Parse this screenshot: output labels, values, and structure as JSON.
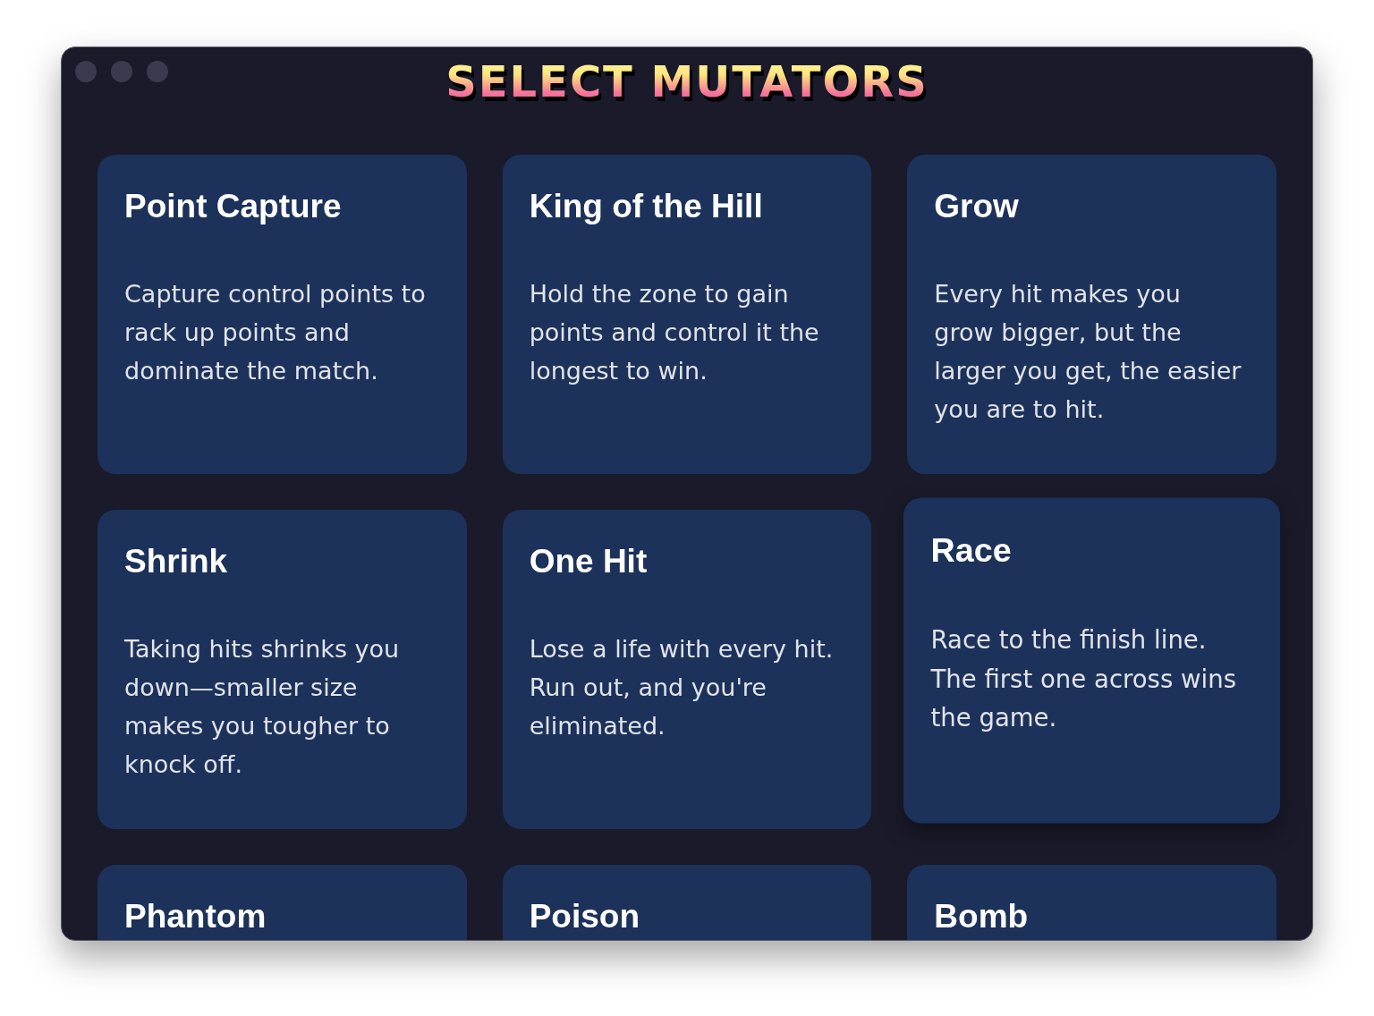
{
  "window": {
    "title": "SELECT MUTATORS"
  },
  "mutators": [
    {
      "name": "Point Capture",
      "description": "Capture control points to rack up points and dominate the match.",
      "hovered": false
    },
    {
      "name": "King of the Hill",
      "description": "Hold the zone to gain points and control it the longest to win.",
      "hovered": false
    },
    {
      "name": "Grow",
      "description": "Every hit makes you grow bigger, but the larger you get, the easier you are to hit.",
      "hovered": false
    },
    {
      "name": "Shrink",
      "description": "Taking hits shrinks you down—smaller size makes you tougher to knock off.",
      "hovered": false
    },
    {
      "name": "One Hit",
      "description": "Lose a life with every hit. Run out, and you're eliminated.",
      "hovered": false
    },
    {
      "name": "Race",
      "description": "Race to the finish line. The first one across wins the game.",
      "hovered": true
    },
    {
      "name": "Phantom",
      "hovered": false
    },
    {
      "name": "Poison",
      "hovered": false
    },
    {
      "name": "Bomb",
      "hovered": false
    }
  ]
}
